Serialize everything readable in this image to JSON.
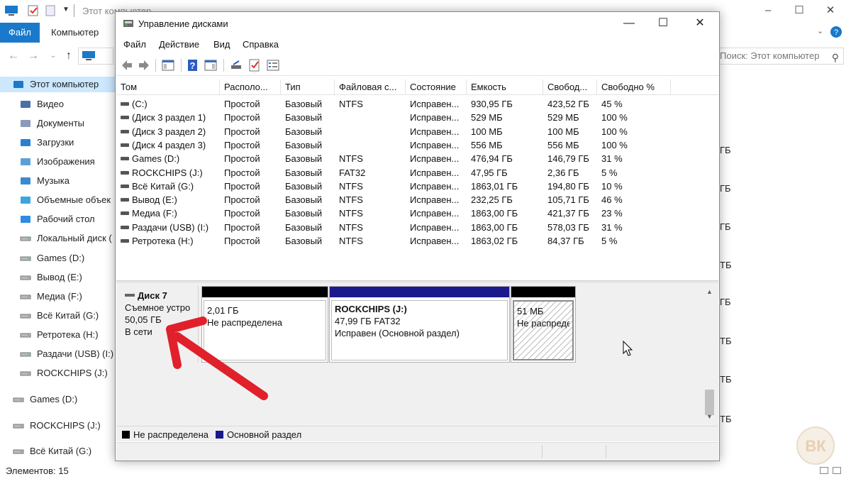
{
  "explorer": {
    "title": "Этот компьютер",
    "tabs": {
      "file": "Файл",
      "computer": "Компьютер"
    },
    "search_placeholder": "Поиск: Этот компьютер",
    "nav": [
      {
        "label": "Этот компьютер",
        "icon": "computer-icon",
        "selected": true
      },
      {
        "label": "Видео",
        "icon": "video-folder-icon"
      },
      {
        "label": "Документы",
        "icon": "documents-folder-icon"
      },
      {
        "label": "Загрузки",
        "icon": "downloads-folder-icon"
      },
      {
        "label": "Изображения",
        "icon": "pictures-folder-icon"
      },
      {
        "label": "Музыка",
        "icon": "music-folder-icon"
      },
      {
        "label": "Объемные объек",
        "icon": "3d-objects-folder-icon"
      },
      {
        "label": "Рабочий стол",
        "icon": "desktop-folder-icon"
      },
      {
        "label": "Локальный диск (",
        "icon": "local-disk-icon"
      },
      {
        "label": "Games (D:)",
        "icon": "drive-icon"
      },
      {
        "label": "Вывод (E:)",
        "icon": "drive-icon"
      },
      {
        "label": "Медиа (F:)",
        "icon": "drive-icon"
      },
      {
        "label": "Всё Китай (G:)",
        "icon": "drive-icon"
      },
      {
        "label": "Ретротека (H:)",
        "icon": "drive-icon"
      },
      {
        "label": "Раздачи (USB) (I:)",
        "icon": "drive-icon"
      },
      {
        "label": "ROCKCHIPS (J:)",
        "icon": "drive-icon"
      },
      {
        "label": "Games (D:)",
        "icon": "drive-icon"
      },
      {
        "label": "ROCKCHIPS (J:)",
        "icon": "drive-icon"
      },
      {
        "label": "Всё Китай (G:)",
        "icon": "drive-icon"
      }
    ],
    "right_col": [
      "ГБ",
      "ГБ",
      "ГБ",
      "ТБ",
      "ГБ",
      "ТБ",
      "ТБ",
      "ТБ",
      "ТБ"
    ],
    "status": "Элементов: 15"
  },
  "dm": {
    "title": "Управление дисками",
    "menu": [
      "Файл",
      "Действие",
      "Вид",
      "Справка"
    ],
    "columns": [
      "Том",
      "Располо...",
      "Тип",
      "Файловая с...",
      "Состояние",
      "Емкость",
      "Свобод...",
      "Свободно %"
    ],
    "rows": [
      [
        "(C:)",
        "Простой",
        "Базовый",
        "NTFS",
        "Исправен...",
        "930,95 ГБ",
        "423,52 ГБ",
        "45 %"
      ],
      [
        "(Диск 3 раздел 1)",
        "Простой",
        "Базовый",
        "",
        "Исправен...",
        "529 МБ",
        "529 МБ",
        "100 %"
      ],
      [
        "(Диск 3 раздел 2)",
        "Простой",
        "Базовый",
        "",
        "Исправен...",
        "100 МБ",
        "100 МБ",
        "100 %"
      ],
      [
        "(Диск 4 раздел 3)",
        "Простой",
        "Базовый",
        "",
        "Исправен...",
        "556 МБ",
        "556 МБ",
        "100 %"
      ],
      [
        "Games (D:)",
        "Простой",
        "Базовый",
        "NTFS",
        "Исправен...",
        "476,94 ГБ",
        "146,79 ГБ",
        "31 %"
      ],
      [
        "ROCKCHIPS (J:)",
        "Простой",
        "Базовый",
        "FAT32",
        "Исправен...",
        "47,95 ГБ",
        "2,36 ГБ",
        "5 %"
      ],
      [
        "Всё Китай (G:)",
        "Простой",
        "Базовый",
        "NTFS",
        "Исправен...",
        "1863,01 ГБ",
        "194,80 ГБ",
        "10 %"
      ],
      [
        "Вывод (E:)",
        "Простой",
        "Базовый",
        "NTFS",
        "Исправен...",
        "232,25 ГБ",
        "105,71 ГБ",
        "46 %"
      ],
      [
        "Медиа (F:)",
        "Простой",
        "Базовый",
        "NTFS",
        "Исправен...",
        "1863,00 ГБ",
        "421,37 ГБ",
        "23 %"
      ],
      [
        "Раздачи (USB) (I:)",
        "Простой",
        "Базовый",
        "NTFS",
        "Исправен...",
        "1863,00 ГБ",
        "578,03 ГБ",
        "31 %"
      ],
      [
        "Ретротека (H:)",
        "Простой",
        "Базовый",
        "NTFS",
        "Исправен...",
        "1863,02 ГБ",
        "84,37 ГБ",
        "5 %"
      ]
    ],
    "disk": {
      "name": "Диск 7",
      "type": "Съемное устро",
      "size": "50,05 ГБ",
      "status": "В сети"
    },
    "partitions": [
      {
        "size": "2,01 ГБ",
        "status": "Не распределена",
        "color": "#000000"
      },
      {
        "name": "ROCKCHIPS  (J:)",
        "size": "47,99 ГБ FAT32",
        "status": "Исправен (Основной раздел)",
        "color": "#1a1a8c"
      },
      {
        "size": "51 МБ",
        "status": "Не распреде",
        "color": "#000000"
      }
    ],
    "legend": [
      {
        "label": "Не распределена",
        "color": "#000000"
      },
      {
        "label": "Основной раздел",
        "color": "#1a1a8c"
      }
    ]
  },
  "annotation": {
    "arrow_color": "#e0202a"
  }
}
